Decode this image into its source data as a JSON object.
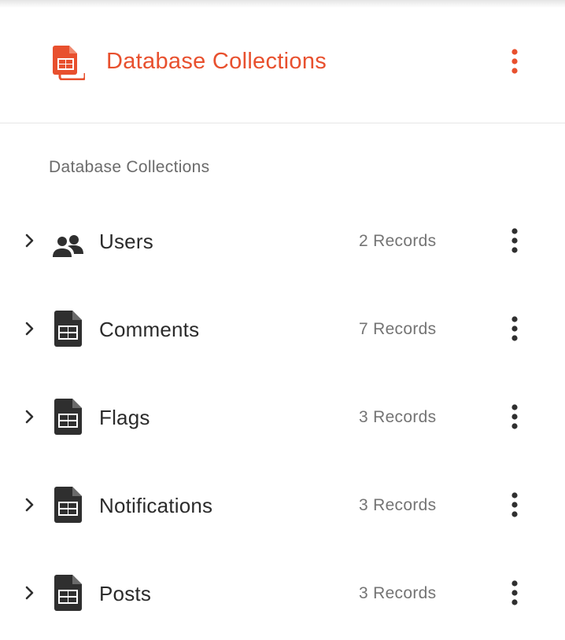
{
  "colors": {
    "accent": "#e8502e",
    "icon_dark": "#2f2f2f",
    "muted_text": "#747474"
  },
  "header": {
    "title": "Database Collections",
    "icon": "database-document-icon",
    "menu_icon": "more-vertical-icon"
  },
  "section": {
    "label": "Database Collections"
  },
  "collections": [
    {
      "name": "Users",
      "records": "2 Records",
      "icon": "users-icon"
    },
    {
      "name": "Comments",
      "records": "7 Records",
      "icon": "table-document-icon"
    },
    {
      "name": "Flags",
      "records": "3 Records",
      "icon": "table-document-icon"
    },
    {
      "name": "Notifications",
      "records": "3 Records",
      "icon": "table-document-icon"
    },
    {
      "name": "Posts",
      "records": "3 Records",
      "icon": "table-document-icon"
    }
  ]
}
